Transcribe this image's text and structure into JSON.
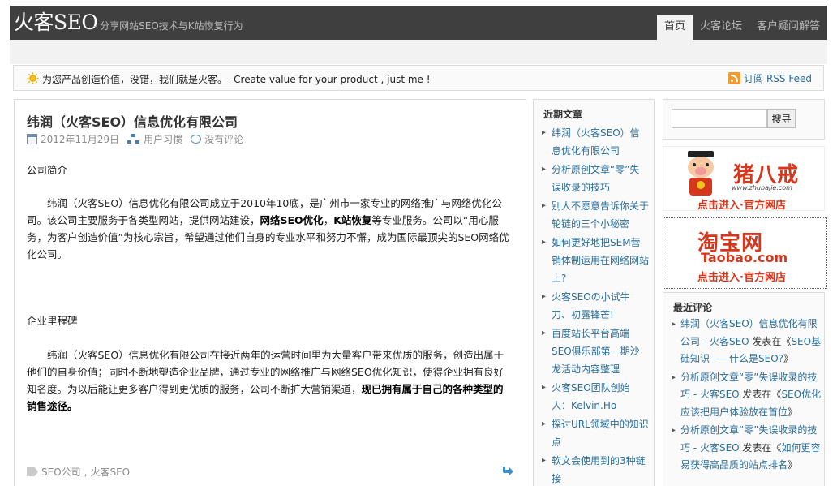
{
  "header": {
    "logo": "火客SEO",
    "tagline": "- 分享网站SEO技术与K站恢复行为",
    "nav": [
      "首页",
      "火客论坛",
      "客户疑问解答"
    ]
  },
  "notice": {
    "text": "为您产品创造价值，没错，我们就是火客。- Create value for your product , just me !",
    "rss": "订阅 RSS Feed"
  },
  "post": {
    "title": "纬润（火客SEO）信息优化有限公司",
    "date": "2012年11月29日",
    "category": "用户习惯",
    "comments": "没有评论",
    "section1_heading": "公司简介",
    "p1_start": "纬润（火客SEO）信息优化有限公司成立于2010年10底，是广州市一家专业的网络推广与网络优化公司。该公司主要服务于各类型网站，提供网站建设，",
    "p1_bold1": "网络SEO优化",
    "p1_sep": "，",
    "p1_bold2": "K站恢复",
    "p1_end": "等专业服务。公司以“用心服务，为客户创造价值”为核心宗旨，希望通过他们自身的专业水平和努力不懈，成为国际最顶尖的SEO网络优化公司。",
    "section2_heading": "企业里程碑",
    "p2_start": "纬润（火客SEO）信息优化有限公司在接近两年的运营时间里为大量客户带来优质的服务，创造出属于他们的自身价值；同时不断地塑造企业品牌，通过专业的网络推广与网络SEO优化知识，使得企业拥有良好知名度。为以后能让更多客户得到更优质的服务，公司不断扩大营销渠道，",
    "p2_bold": "现已拥有属于自己的各种类型的销售途径。",
    "tags": [
      "SEO公司",
      "火客SEO"
    ],
    "tag_sep": ", "
  },
  "recent_posts": {
    "title": "近期文章",
    "items": [
      "纬润（火客SEO）信息优化有限公司",
      "分析原创文章“零”失误收录的技巧",
      "别人不愿意告诉你关于轮链的三个小秘密",
      "如何更好地把SEM营销体制运用在网络网站上?",
      "火客SEOの小试牛刀、初露锋芒!",
      "百度站长平台高端SEO俱乐部第一期沙龙活动内容整理",
      "火客SEO团队创始人：Kelvin.Ho",
      "探讨URL领域中的知识点",
      "软文会使用到的3种链接"
    ]
  },
  "search": {
    "button": "搜寻",
    "value": ""
  },
  "ads": {
    "zbj_name": "猪八戒",
    "zbj_url": "www.zhubajie.com",
    "zbj_cta": "点击进入·官方网店",
    "taobao_name": "淘宝网",
    "taobao_url": "Taobao.com",
    "taobao_cta": "点击进入·官方网店"
  },
  "recent_comments": {
    "title": "最近评论",
    "items": [
      {
        "author": "纬润（火客SEO）信息优化有限公司 - 火客SEO",
        "said": " 发表在《",
        "post": "SEO基础知识——什么是SEO?",
        "end": "》"
      },
      {
        "author": "分析原创文章“零”失误收录的技巧 - 火客SEO",
        "said": " 发表在《",
        "post": "SEO优化应该把用户体验放在首位",
        "end": "》"
      },
      {
        "author": "分析原创文章“零”失误收录的技巧 - 火客SEO",
        "said": " 发表在《",
        "post": "如何更容易获得高品质的站点排名",
        "end": "》"
      }
    ]
  },
  "colors": {
    "header_bg": "#3f3f3f",
    "link": "#2b6f9c",
    "ad_red": "#d6361b"
  }
}
